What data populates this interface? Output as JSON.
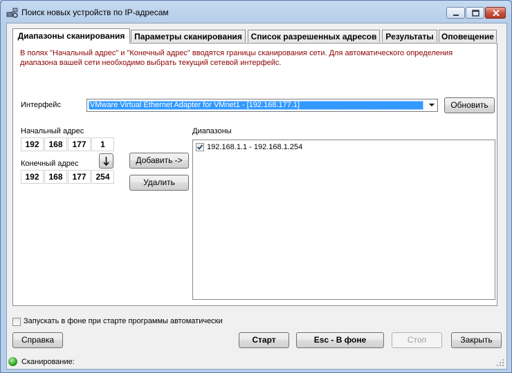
{
  "window": {
    "title": "Поиск новых устройств по IP-адресам",
    "controls": [
      "minimize",
      "maximize",
      "close"
    ]
  },
  "tabs": [
    {
      "label": "Диапазоны сканирования",
      "active": true
    },
    {
      "label": "Параметры сканирования",
      "active": false
    },
    {
      "label": "Список разрешенных адресов",
      "active": false
    },
    {
      "label": "Результаты",
      "active": false
    },
    {
      "label": "Оповещение",
      "active": false
    }
  ],
  "info_text": "В полях \"Начальный адрес\" и \"Конечный адрес\" вводятся границы сканирования сети. Для автоматического определения диапазона вашей сети необходимо выбрать текущий сетевой интерфейс.",
  "interface": {
    "label": "Интерфейс",
    "selected": "VMware Virtual Ethernet Adapter for VMnet1 - [192.168.177.1]",
    "refresh_label": "Обновить"
  },
  "start_address": {
    "label": "Начальный адрес",
    "octets": [
      "192",
      "168",
      "177",
      "1"
    ]
  },
  "end_address": {
    "label": "Конечный адрес",
    "octets": [
      "192",
      "168",
      "177",
      "254"
    ],
    "copy_icon": "arrow-down-icon"
  },
  "actions": {
    "add_label": "Добавить ->",
    "delete_label": "Удалить"
  },
  "ranges": {
    "label": "Диапазоны",
    "items": [
      {
        "text": "192.168.1.1 - 192.168.1.254",
        "checked": true
      }
    ]
  },
  "autostart": {
    "label": "Запускать в фоне при старте программы автоматически",
    "checked": false
  },
  "buttons": {
    "help": "Справка",
    "start": "Старт",
    "background": "Esc - В фоне",
    "stop": "Стоп",
    "close": "Закрыть"
  },
  "status": {
    "text": "Сканирование:",
    "indicator_color": "#27a21b"
  },
  "colors": {
    "info_text": "#8b0000",
    "selection": "#3399ff"
  }
}
